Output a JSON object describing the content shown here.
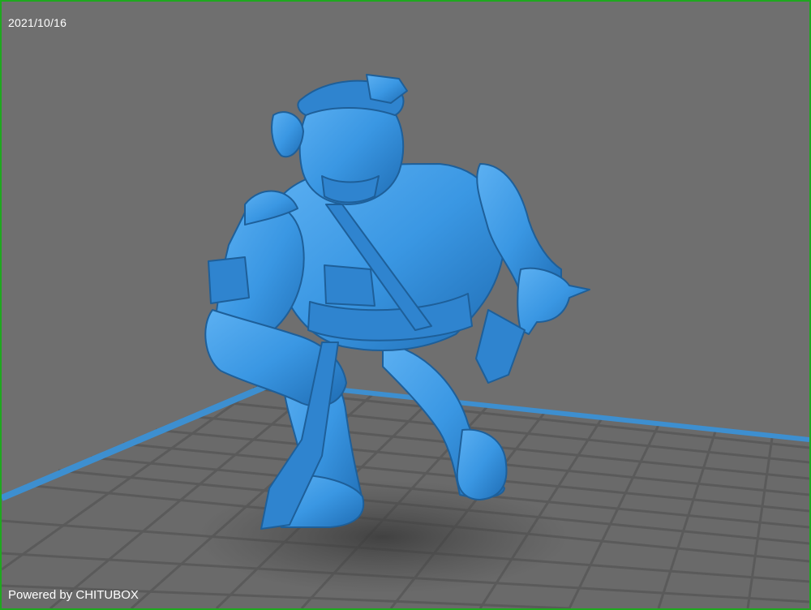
{
  "viewport": {
    "date": "2021/10/16",
    "watermark": "Powered by CHITUBOX"
  },
  "scene": {
    "model_icon": "miniature-model-icon",
    "platform": "build-plate-grid"
  },
  "colors": {
    "background": "#6f6f6f",
    "grid_line": "#5a5a5a",
    "plate_edge": "#3d8fd0",
    "model": "#3a97e3",
    "model_shadow": "#1e5f99",
    "frame": "#1fa81f"
  }
}
